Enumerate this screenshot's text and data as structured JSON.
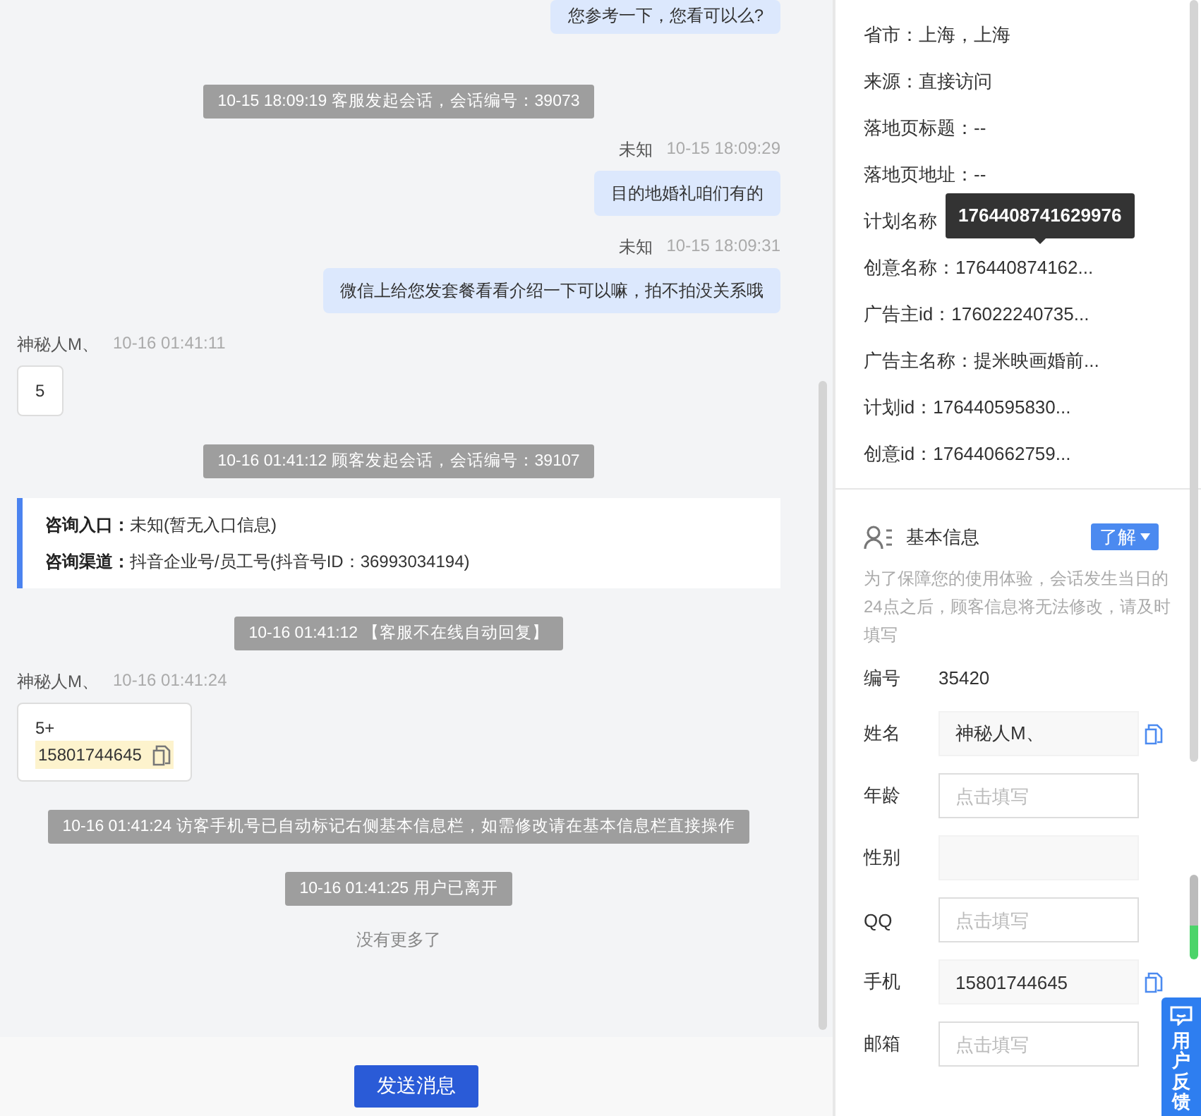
{
  "chat": {
    "messages": [
      {
        "kind": "agent",
        "text": "您参考一下，您看可以么?"
      },
      {
        "kind": "system",
        "text": "10-15 18:09:19 客服发起会话，会话编号：39073"
      },
      {
        "kind": "agent",
        "sender": "未知",
        "time": "10-15 18:09:29",
        "text": "目的地婚礼咱们有的"
      },
      {
        "kind": "agent",
        "sender": "未知",
        "time": "10-15 18:09:31",
        "text": "微信上给您发套餐看看介绍一下可以嘛，拍不拍没关系哦"
      },
      {
        "kind": "visitor",
        "sender": "神秘人M、",
        "time": "10-16 01:41:11",
        "lines": [
          {
            "text": "5",
            "highlighted": false
          }
        ]
      },
      {
        "kind": "system",
        "text": "10-16 01:41:12 顾客发起会话，会话编号：39107"
      },
      {
        "kind": "info",
        "rows": [
          {
            "label": "咨询入口：",
            "value": "未知(暂无入口信息)"
          },
          {
            "label": "咨询渠道：",
            "value": "抖音企业号/员工号(抖音号ID：36993034194)"
          }
        ]
      },
      {
        "kind": "system",
        "text": "10-16 01:41:12 【客服不在线自动回复】"
      },
      {
        "kind": "visitor",
        "sender": "神秘人M、",
        "time": "10-16 01:41:24",
        "lines": [
          {
            "text": "5+",
            "highlighted": false
          },
          {
            "text": "15801744645",
            "highlighted": true
          }
        ]
      },
      {
        "kind": "system",
        "text": "10-16 01:41:24 访客手机号已自动标记右侧基本信息栏，如需修改请在基本信息栏直接操作"
      },
      {
        "kind": "system",
        "text": "10-16 01:41:25 用户已离开"
      }
    ],
    "end_note": "没有更多了",
    "send_button": "发送消息"
  },
  "details": {
    "rows": [
      {
        "text": "省市：上海，上海"
      },
      {
        "text": "来源：直接访问"
      },
      {
        "text": "落地页标题：--"
      },
      {
        "text": "落地页地址：--"
      },
      {
        "text": "计划名称",
        "tooltip": "1764408741629976"
      },
      {
        "text": "创意名称：176440874162..."
      },
      {
        "text": "广告主id：176022240735..."
      },
      {
        "text": "广告主名称：提米映画婚前..."
      },
      {
        "text": "计划id：176440595830..."
      },
      {
        "text": "创意id：176440662759..."
      }
    ]
  },
  "basic_info": {
    "title": "基本信息",
    "learn_button": "了解",
    "notice": "为了保障您的使用体验，会话发生当日的24点之后，顾客信息将无法修改，请及时填写",
    "id_label": "编号",
    "id_value": "35420",
    "fields": [
      {
        "kind": "readonly",
        "label": "姓名",
        "value": "神秘人M、",
        "copy": true
      },
      {
        "kind": "input",
        "label": "年龄",
        "placeholder": "点击填写"
      },
      {
        "kind": "readonly",
        "label": "性别",
        "copy": false
      },
      {
        "kind": "input",
        "label": "QQ",
        "placeholder": "点击填写"
      },
      {
        "kind": "readonly",
        "label": "手机",
        "value": "15801744645",
        "copy": true
      },
      {
        "kind": "input",
        "label": "邮箱",
        "placeholder": "点击填写"
      }
    ]
  },
  "feedback_tab": "用户反馈"
}
